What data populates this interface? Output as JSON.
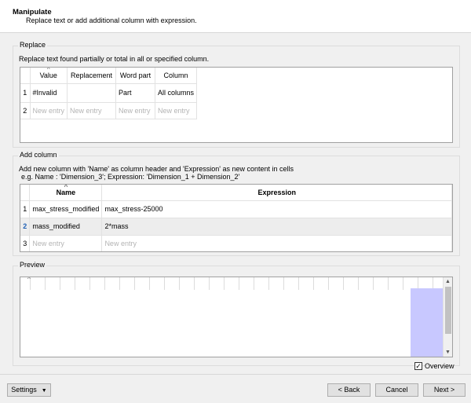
{
  "header": {
    "title": "Manipulate",
    "subtitle": "Replace text or add additional column with expression."
  },
  "replace": {
    "legend": "Replace",
    "description": "Replace text found partially or total in all or specified column.",
    "columns": [
      "Value",
      "Replacement",
      "Word part",
      "Column"
    ],
    "rows": [
      {
        "num": "1",
        "cells": [
          "#Invalid",
          "",
          "Part",
          "All columns"
        ]
      },
      {
        "num": "2",
        "cells": [
          "New entry",
          "New entry",
          "New entry",
          "New entry"
        ],
        "placeholder": true
      }
    ]
  },
  "add_column": {
    "legend": "Add column",
    "description_line1": "Add new column with 'Name' as column header and 'Expression' as new content in cells",
    "description_line2": "e.g. Name : 'Dimension_3'; Expression: 'Dimension_1 + Dimension_2'",
    "columns": [
      "Name",
      "Expression"
    ],
    "rows": [
      {
        "num": "1",
        "cells": [
          "max_stress_modified",
          "max_stress-25000"
        ]
      },
      {
        "num": "2",
        "cells": [
          "mass_modified",
          "2*mass"
        ],
        "selected": true
      },
      {
        "num": "3",
        "cells": [
          "New entry",
          "New entry"
        ],
        "placeholder": true
      }
    ]
  },
  "preview": {
    "legend": "Preview",
    "overview_label": "Overview",
    "overview_checked": true
  },
  "footer": {
    "settings_label": "Settings",
    "back_label": "< Back",
    "cancel_label": "Cancel",
    "next_label": "Next >"
  }
}
